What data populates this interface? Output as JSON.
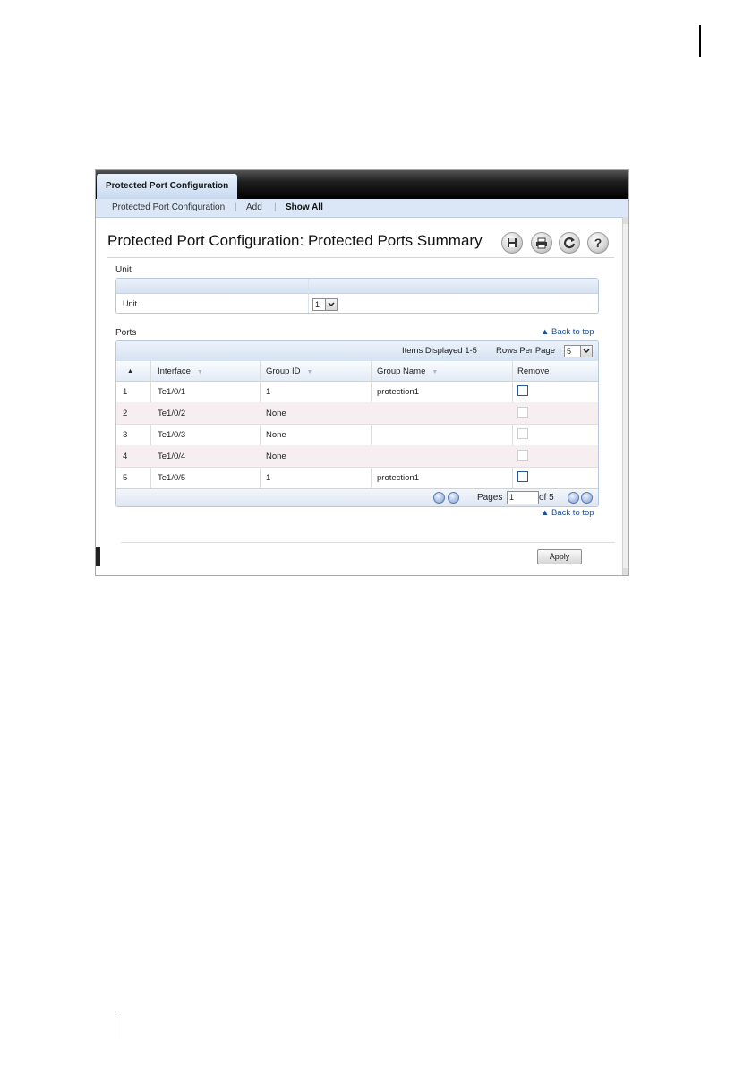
{
  "window": {
    "active_tab": "Protected Port Configuration",
    "subnav": [
      "Protected Port Configuration",
      "|",
      "Add",
      "|",
      "Show All"
    ]
  },
  "page": {
    "title": "Protected Port Configuration: Protected Ports Summary",
    "toolbar_icons": [
      "save-icon",
      "print-icon",
      "refresh-icon",
      "help-icon"
    ],
    "help_glyph": "?"
  },
  "unit_section": {
    "label": "Unit",
    "row_label": "Unit",
    "selected": "1"
  },
  "ports_section": {
    "label": "Ports",
    "back_to_top": "▲ Back to top",
    "items_displayed": "Items Displayed 1-5",
    "rows_per_page_label": "Rows Per Page",
    "rows_per_page": "5",
    "columns": [
      "▲",
      "Interface",
      "Group ID",
      "Group Name",
      "Remove"
    ],
    "rows": [
      {
        "index": "1",
        "interface": "Te1/0/1",
        "group_id": "1",
        "group_name": "protection1",
        "remove_enabled": true
      },
      {
        "index": "2",
        "interface": "Te1/0/2",
        "group_id": "None",
        "group_name": "",
        "remove_enabled": false
      },
      {
        "index": "3",
        "interface": "Te1/0/3",
        "group_id": "None",
        "group_name": "",
        "remove_enabled": false
      },
      {
        "index": "4",
        "interface": "Te1/0/4",
        "group_id": "None",
        "group_name": "",
        "remove_enabled": false
      },
      {
        "index": "5",
        "interface": "Te1/0/5",
        "group_id": "1",
        "group_name": "protection1",
        "remove_enabled": true
      }
    ],
    "pager": {
      "pages_label": "Pages",
      "current_page": "1",
      "of_label": "of 5"
    },
    "back_to_top_bottom": "▲ Back to top"
  },
  "footer": {
    "apply_label": "Apply"
  }
}
